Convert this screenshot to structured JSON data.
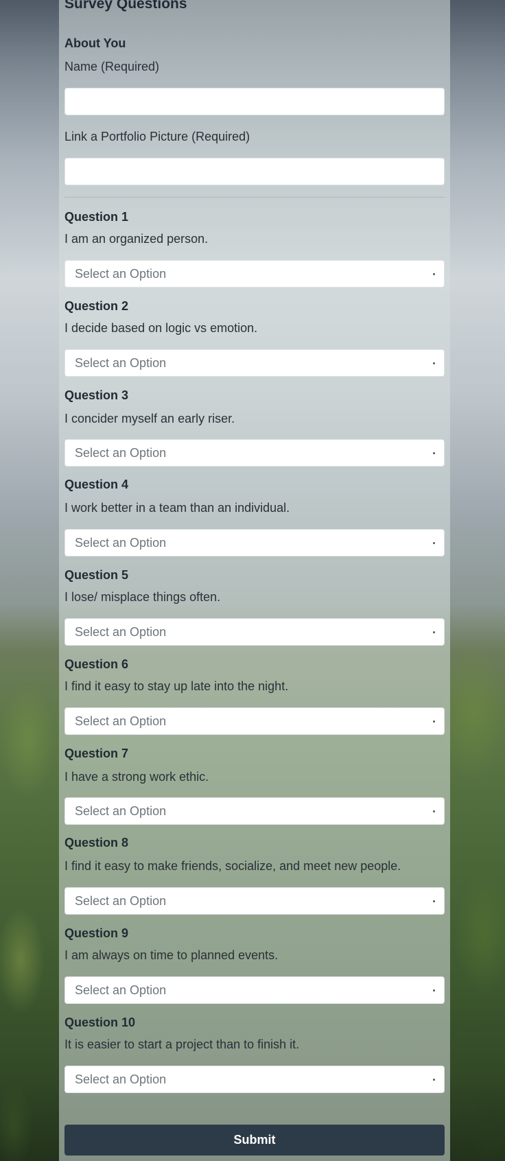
{
  "form": {
    "title": "Survey Questions",
    "about_heading": "About You",
    "name_label": "Name (Required)",
    "name_value": "",
    "portfolio_label": "Link a Portfolio Picture (Required)",
    "portfolio_value": "",
    "select_placeholder": "Select an Option",
    "submit_label": "Submit"
  },
  "questions": [
    {
      "heading": "Question 1",
      "text": "I am an organized person."
    },
    {
      "heading": "Question 2",
      "text": "I decide based on logic vs emotion."
    },
    {
      "heading": "Question 3",
      "text": "I concider myself an early riser."
    },
    {
      "heading": "Question 4",
      "text": "I work better in a team than an individual."
    },
    {
      "heading": "Question 5",
      "text": "I lose/ misplace things often."
    },
    {
      "heading": "Question 6",
      "text": "I find it easy to stay up late into the night."
    },
    {
      "heading": "Question 7",
      "text": "I have a strong work ethic."
    },
    {
      "heading": "Question 8",
      "text": "I find it easy to make friends, socialize, and meet new people."
    },
    {
      "heading": "Question 9",
      "text": "I am always on time to planned events."
    },
    {
      "heading": "Question 10",
      "text": "It is easier to start a project than to finish it."
    }
  ]
}
